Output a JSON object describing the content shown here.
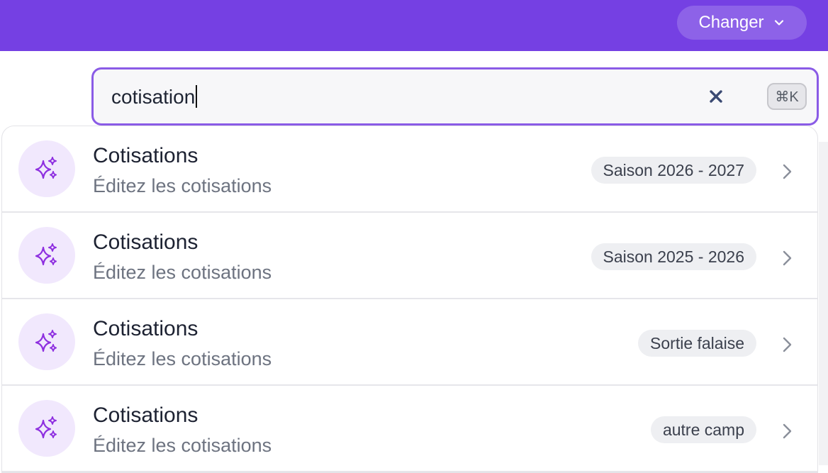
{
  "header": {
    "changer_label": "Changer",
    "changer_icon": "chevron-down-icon",
    "background_color": "#7540e3"
  },
  "search": {
    "value": "cotisation",
    "clear_icon": "close-icon",
    "shortcut": "⌘K",
    "border_color": "#8a5be6"
  },
  "results": [
    {
      "icon": "sparkles-icon",
      "title": "Cotisations",
      "subtitle": "Éditez les cotisations",
      "badge": "Saison 2026 - 2027"
    },
    {
      "icon": "sparkles-icon",
      "title": "Cotisations",
      "subtitle": "Éditez les cotisations",
      "badge": "Saison 2025 - 2026"
    },
    {
      "icon": "sparkles-icon",
      "title": "Cotisations",
      "subtitle": "Éditez les cotisations",
      "badge": "Sortie falaise"
    },
    {
      "icon": "sparkles-icon",
      "title": "Cotisations",
      "subtitle": "Éditez les cotisations",
      "badge": "autre camp"
    }
  ],
  "colors": {
    "accent": "#7540e3",
    "icon_purple": "#8e2fe0",
    "icon_bg": "#f1e8fd"
  }
}
